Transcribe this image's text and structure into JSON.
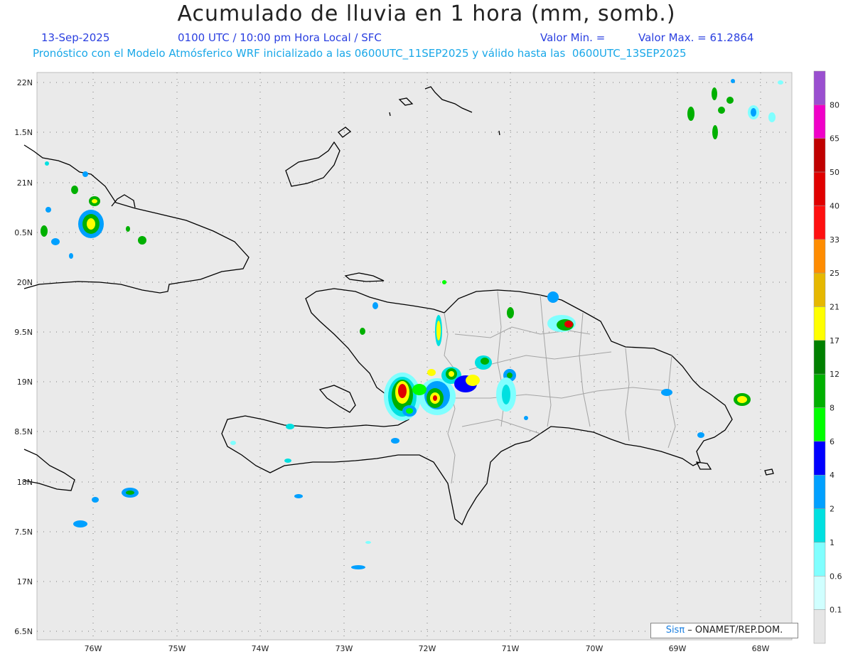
{
  "header": {
    "title": "Acumulado de lluvia en 1 hora (mm, somb.)",
    "date": "13-Sep-2025",
    "time_info": "0100 UTC / 10:00 pm Hora Local / SFC",
    "valor_min": "Valor Min. =",
    "valor_max": "Valor Max. = 61.2864",
    "forecast_note": "Pronóstico con el Modelo Atmósferico WRF inicializado a las 0600UTC_11SEP2025 y válido hasta las  0600UTC_13SEP2025"
  },
  "axes": {
    "lat_labels": [
      "22N",
      "1.5N",
      "21N",
      "0.5N",
      "20N",
      "9.5N",
      "19N",
      "8.5N",
      "18N",
      "7.5N",
      "17N",
      "6.5N"
    ],
    "lon_labels": [
      "76W",
      "75W",
      "74W",
      "73W",
      "72W",
      "71W",
      "70W",
      "69W",
      "68W"
    ]
  },
  "legend": {
    "labels": [
      "80",
      "65",
      "50",
      "40",
      "33",
      "25",
      "21",
      "17",
      "12",
      "8",
      "6",
      "4",
      "2",
      "1",
      "0.6",
      "0.1"
    ],
    "colors": [
      "#9a4fd0",
      "#f000c8",
      "#c00000",
      "#e00000",
      "#ff1010",
      "#ff8c00",
      "#e6b800",
      "#ffff00",
      "#008000",
      "#00b000",
      "#00ff00",
      "#0000ff",
      "#00a0ff",
      "#00e0e0",
      "#80ffff",
      "#d0ffff",
      "#e6e6e6"
    ]
  },
  "credit": {
    "logo": "Sisπ",
    "text": " – ONAMET/REP.DOM."
  },
  "colors": {
    "background": "#eaeaea",
    "coast": "#000000",
    "borders": "#a0a0a0"
  }
}
